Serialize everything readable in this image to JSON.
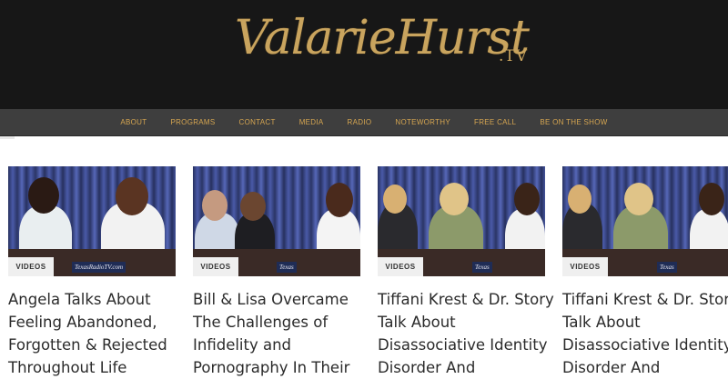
{
  "logo": {
    "name": "ValarieHurst",
    "suffix": ".TV"
  },
  "nav": [
    "ABOUT",
    "PROGRAMS",
    "CONTACT",
    "MEDIA",
    "RADIO",
    "NOTEWORTHY",
    "FREE CALL",
    "BE ON THE SHOW"
  ],
  "cards": [
    {
      "badge": "VIDEOS",
      "title": "Angela Talks About Feeling Abandoned, Forgotten & Rejected Throughout Life",
      "sign": "TexasRadioTV.com"
    },
    {
      "badge": "VIDEOS",
      "title": "Bill & Lisa Overcame The Challenges of Infidelity and Pornography In Their",
      "sign": "Texas"
    },
    {
      "badge": "VIDEOS",
      "title": "Tiffani Krest & Dr. Story Talk About Disassociative Identity Disorder And",
      "sign": "Texas"
    },
    {
      "badge": "VIDEOS",
      "title": "Tiffani Krest & Dr. Story Talk About Disassociative Identity Disorder And",
      "sign": "Texas"
    }
  ],
  "colors": {
    "header_bg": "#171717",
    "nav_bg": "#3e3e3e",
    "nav_text": "#d6a651",
    "logo_gold": "#c9a45e"
  }
}
